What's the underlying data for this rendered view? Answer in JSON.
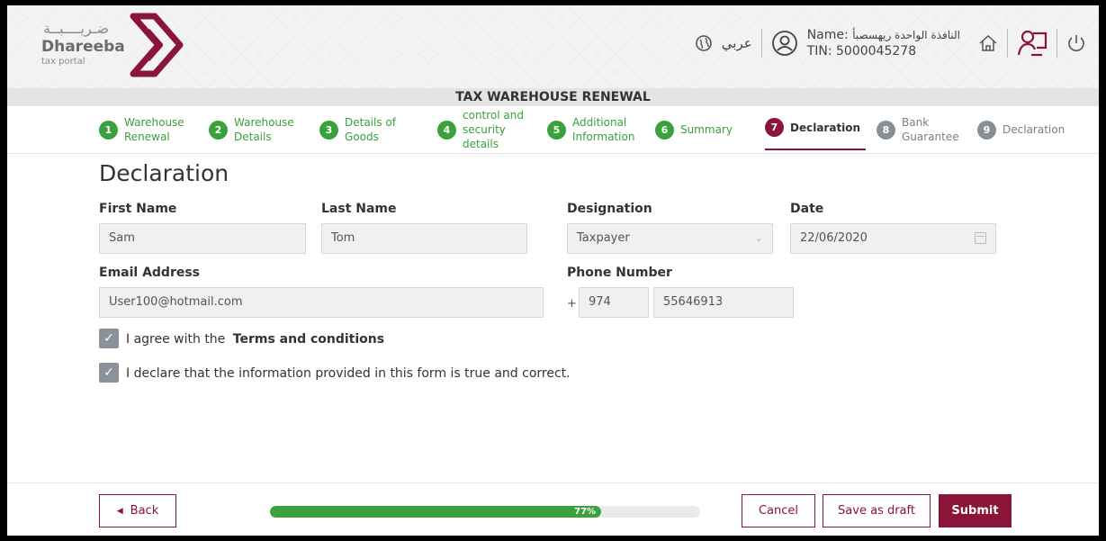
{
  "header": {
    "logo_arabic": "ضـريــــبــة",
    "logo_name": "Dhareeba",
    "logo_sub": "tax portal",
    "language_label": "عربي",
    "user_name_label": "Name:",
    "user_name_value": "النافذة الواحدة ريهسصبأ",
    "tin_label": "TIN: 5000045278"
  },
  "page_heading": "TAX WAREHOUSE RENEWAL",
  "steps": [
    {
      "num": "1",
      "label": "Warehouse Renewal",
      "state": "done"
    },
    {
      "num": "2",
      "label": "Warehouse Details",
      "state": "done"
    },
    {
      "num": "3",
      "label": "Details of Goods",
      "state": "done"
    },
    {
      "num": "4",
      "label": "control and security details",
      "state": "done"
    },
    {
      "num": "5",
      "label": "Additional Information",
      "state": "done"
    },
    {
      "num": "6",
      "label": "Summary",
      "state": "done"
    },
    {
      "num": "7",
      "label": "Declaration",
      "state": "active"
    },
    {
      "num": "8",
      "label": "Bank Guarantee",
      "state": "todo"
    },
    {
      "num": "9",
      "label": "Declaration",
      "state": "todo"
    }
  ],
  "form": {
    "title": "Declaration",
    "first_name_label": "First Name",
    "first_name_value": "Sam",
    "last_name_label": "Last Name",
    "last_name_value": "Tom",
    "designation_label": "Designation",
    "designation_value": "Taxpayer",
    "date_label": "Date",
    "date_value": "22/06/2020",
    "email_label": "Email Address",
    "email_value": "User100@hotmail.com",
    "phone_label": "Phone Number",
    "phone_plus": "+",
    "phone_code": "974",
    "phone_number": "55646913",
    "agree_prefix": "I agree with the",
    "agree_link": "Terms and conditions",
    "declare_text": "I declare that the information provided in this form is true and correct."
  },
  "footer": {
    "back_label": "Back",
    "progress_percent": 77,
    "progress_text": "77%",
    "cancel_label": "Cancel",
    "save_draft_label": "Save as draft",
    "submit_label": "Submit"
  },
  "colors": {
    "brand": "#8a1538",
    "success": "#3aa13c"
  }
}
